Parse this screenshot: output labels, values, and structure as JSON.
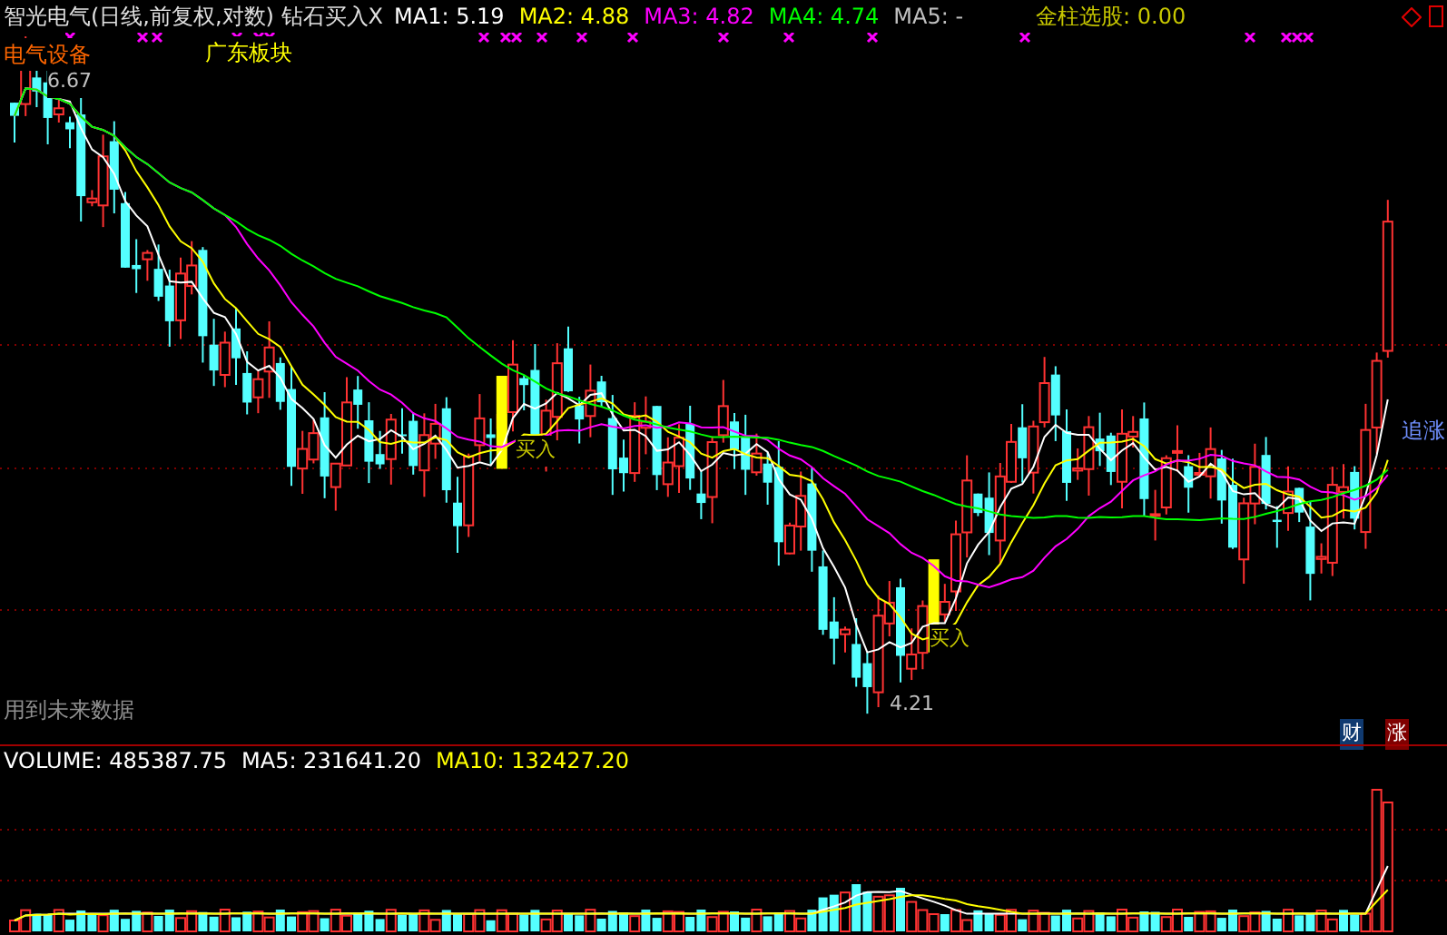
{
  "header": {
    "title": "智光电气(日线,前复权,对数) 钻石买入X",
    "indicators": [
      {
        "label": "MA1: 5.19",
        "color": "#ffffff"
      },
      {
        "label": "MA2: 4.88",
        "color": "#ffff00"
      },
      {
        "label": "MA3: 4.82",
        "color": "#ff00ff"
      },
      {
        "label": "MA4: 4.74",
        "color": "#00ff00"
      },
      {
        "label": "MA5: -",
        "color": "#c0c0c0"
      }
    ],
    "screener": "金柱选股: 0.00"
  },
  "sector_tags": [
    {
      "text": "电气设备",
      "color": "#ff6600"
    },
    {
      "text": "广东板块",
      "color": "#ffff00"
    }
  ],
  "price_labels": {
    "high": "6.67",
    "low": "4.21"
  },
  "signals": [
    "买入",
    "买入",
    "追涨"
  ],
  "notice": "用到未来数据",
  "badges": [
    "财",
    "涨"
  ],
  "volume_header": [
    {
      "label": "VOLUME: 485387.75",
      "color": "#ffffff"
    },
    {
      "label": "MA5: 231641.20",
      "color": "#ffffff"
    },
    {
      "label": "MA10: 132427.20",
      "color": "#ffff00"
    }
  ]
}
